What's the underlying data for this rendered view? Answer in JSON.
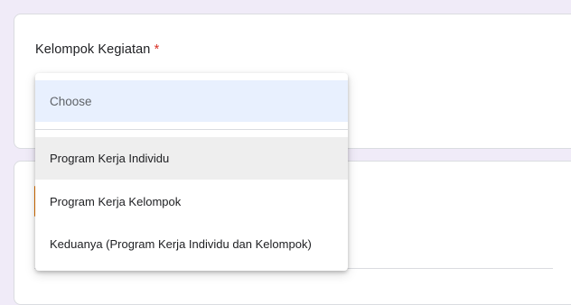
{
  "question": {
    "title": "Kelompok Kegiatan",
    "required_mark": "*"
  },
  "dropdown": {
    "placeholder": "Choose",
    "options": [
      {
        "label": "Program Kerja Individu",
        "highlighted": true
      },
      {
        "label": "Program Kerja Kelompok",
        "highlighted": false
      },
      {
        "label": "Keduanya (Program Kerja Individu dan Kelompok)",
        "highlighted": false
      }
    ]
  },
  "colors": {
    "background": "#f0ebf8",
    "required": "#d93025",
    "selected_bg": "#e8f0fe",
    "hover_bg": "#eeeeee",
    "accent": "#e37400"
  }
}
